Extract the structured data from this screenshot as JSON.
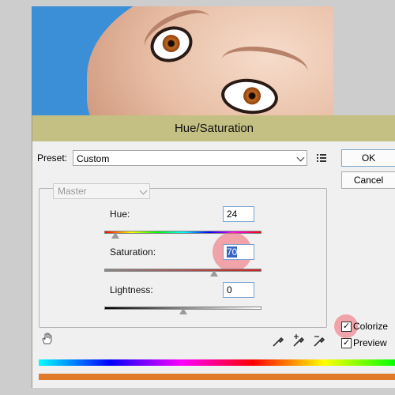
{
  "dialog": {
    "title": "Hue/Saturation",
    "preset_label": "Preset:",
    "preset_value": "Custom",
    "ok_label": "OK",
    "cancel_label": "Cancel",
    "channel_value": "Master",
    "hue_label": "Hue:",
    "hue_value": "24",
    "hue_fraction": 0.07,
    "saturation_label": "Saturation:",
    "saturation_value": "70",
    "saturation_fraction": 0.7,
    "lightness_label": "Lightness:",
    "lightness_value": "0",
    "lightness_fraction": 0.5,
    "colorize_label": "Colorize",
    "colorize_checked": true,
    "preview_label": "Preview",
    "preview_checked": true,
    "checkmark": "✓"
  },
  "icons": [
    "preset-menu-icon",
    "hand-adjust-icon",
    "eyedropper-icon",
    "eyedropper-plus-icon",
    "eyedropper-minus-icon"
  ],
  "colors": {
    "titlebar": "#c4bf82",
    "selection": "#3366c8",
    "highlight": "#f0646e",
    "result_bar": "#e07a2a"
  }
}
